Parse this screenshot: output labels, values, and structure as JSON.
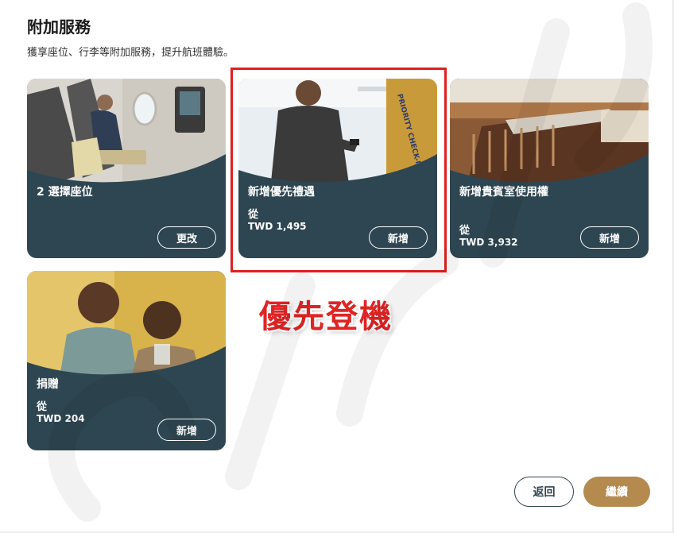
{
  "header": {
    "title": "附加服務",
    "subtitle": "獲享座位、行李等附加服務，提升航班體驗。"
  },
  "cards": [
    {
      "title": "2 選擇座位",
      "from": "",
      "price": "",
      "button": "更改"
    },
    {
      "title": "新增優先禮遇",
      "from": "從",
      "price": "TWD  1,495",
      "button": "新增"
    },
    {
      "title": "新增貴賓室使用權",
      "from": "從",
      "price": "TWD  3,932",
      "button": "新增"
    },
    {
      "title": "捐贈",
      "from": "從",
      "price": "TWD  204",
      "button": "新增"
    }
  ],
  "annotation": {
    "text": "優先登機",
    "color": "#e02424"
  },
  "footer": {
    "back_label": "返回",
    "continue_label": "繼續"
  },
  "colors": {
    "card_bg": "#2e4651",
    "accent_gold": "#b48a4f",
    "highlight": "#e01f1f"
  }
}
